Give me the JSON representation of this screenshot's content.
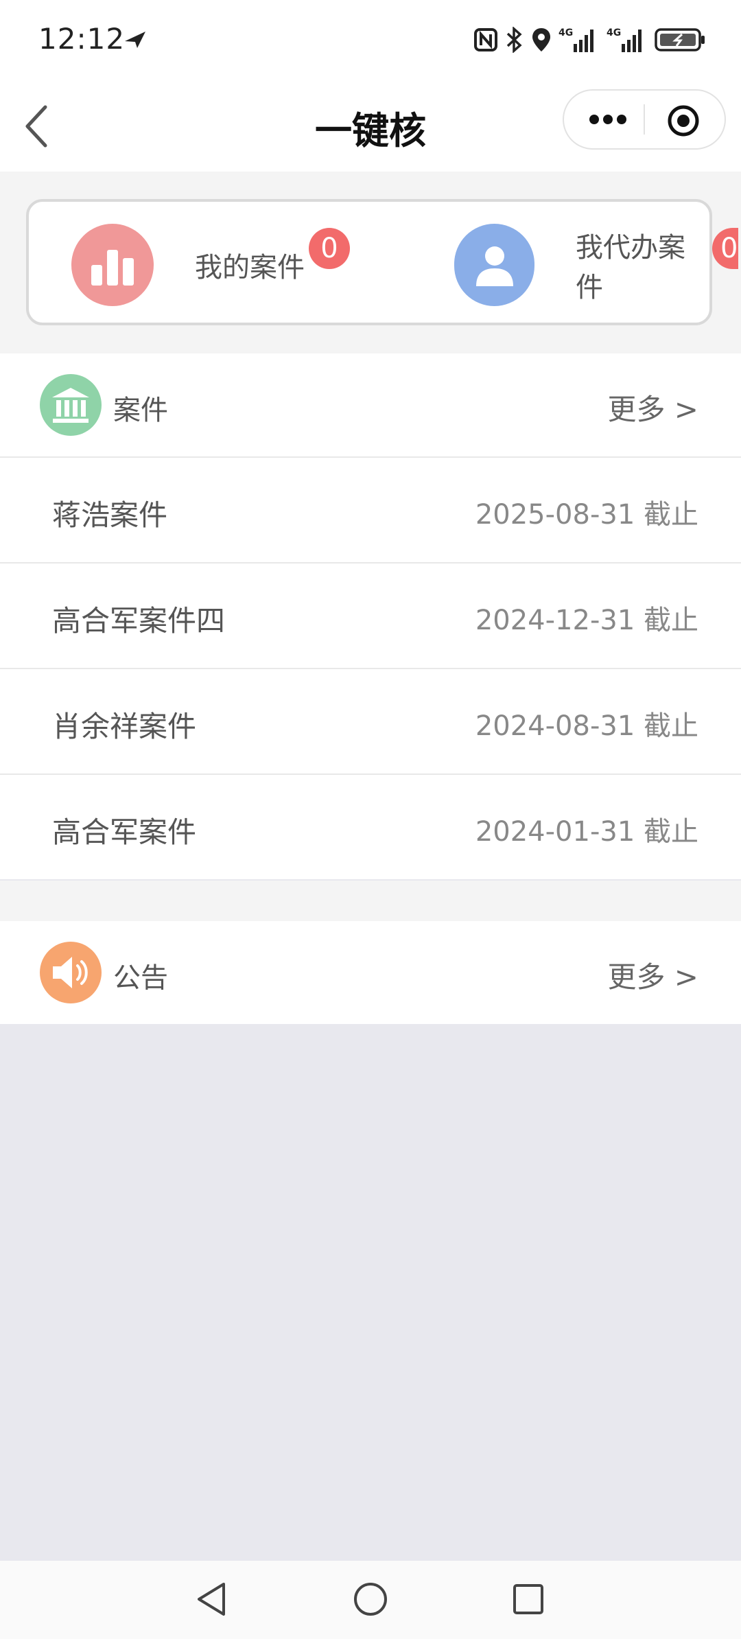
{
  "status_bar": {
    "time": "12:12"
  },
  "nav": {
    "title": "一键核"
  },
  "quick_actions": [
    {
      "label": "我的案件",
      "badge": "0"
    },
    {
      "label": "我代办案件",
      "badge": "0"
    }
  ],
  "cases_section": {
    "title": "案件",
    "more": "更多 >",
    "items": [
      {
        "name": "蒋浩案件",
        "deadline": "2025-08-31 截止"
      },
      {
        "name": "高合军案件四",
        "deadline": "2024-12-31 截止"
      },
      {
        "name": "肖余祥案件",
        "deadline": "2024-08-31 截止"
      },
      {
        "name": "高合军案件",
        "deadline": "2024-01-31 截止"
      }
    ]
  },
  "notice_section": {
    "title": "公告",
    "more": "更多 >"
  },
  "colors": {
    "badge": "#f26b6b",
    "case_icon": "#8fd3a8",
    "notice_icon": "#f7a56f",
    "chart_icon": "#f09898",
    "user_icon": "#8aaee8"
  }
}
